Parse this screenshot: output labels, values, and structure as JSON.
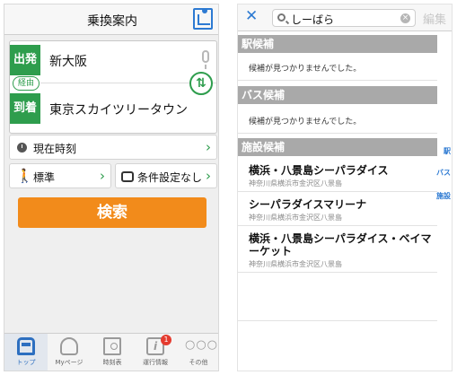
{
  "left": {
    "title": "乗換案内",
    "departure_tag": "出発",
    "departure_station": "新大阪",
    "via_label": "経由",
    "arrival_tag": "到着",
    "arrival_station": "東京スカイツリータウン",
    "time_label": "現在時刻",
    "mode_label": "標準",
    "condition_label": "条件設定なし",
    "search_button": "検索",
    "tabs": [
      {
        "label": "トップ",
        "icon": "train-icon",
        "active": true
      },
      {
        "label": "Myページ",
        "icon": "person-icon",
        "active": false
      },
      {
        "label": "時刻表",
        "icon": "timetable-icon",
        "active": false
      },
      {
        "label": "運行情報",
        "icon": "info-icon",
        "active": false,
        "badge": "1"
      },
      {
        "label": "その他",
        "icon": "more-icon",
        "active": false
      }
    ],
    "colors": {
      "accent_green": "#2e9d4d",
      "search_orange": "#f28b1b",
      "brand_blue": "#2d6fc0"
    }
  },
  "right": {
    "close_label": "✕",
    "search_query": "しーばら",
    "edit_label": "編集",
    "sections": {
      "station": {
        "title": "駅候補",
        "empty_text": "候補が見つかりませんでした。"
      },
      "bus": {
        "title": "バス候補",
        "empty_text": "候補が見つかりませんでした。"
      },
      "facility": {
        "title": "施設候補"
      }
    },
    "facilities": [
      {
        "name": "横浜・八景島シーパラダイス",
        "address": "神奈川県横浜市金沢区八景島"
      },
      {
        "name": "シーパラダイスマリーナ",
        "address": "神奈川県横浜市金沢区八景島"
      },
      {
        "name": "横浜・八景島シーパラダイス・ベイマーケット",
        "address": "神奈川県横浜市金沢区八景島"
      }
    ],
    "index_labels": [
      "駅",
      "バス",
      "施設"
    ]
  }
}
